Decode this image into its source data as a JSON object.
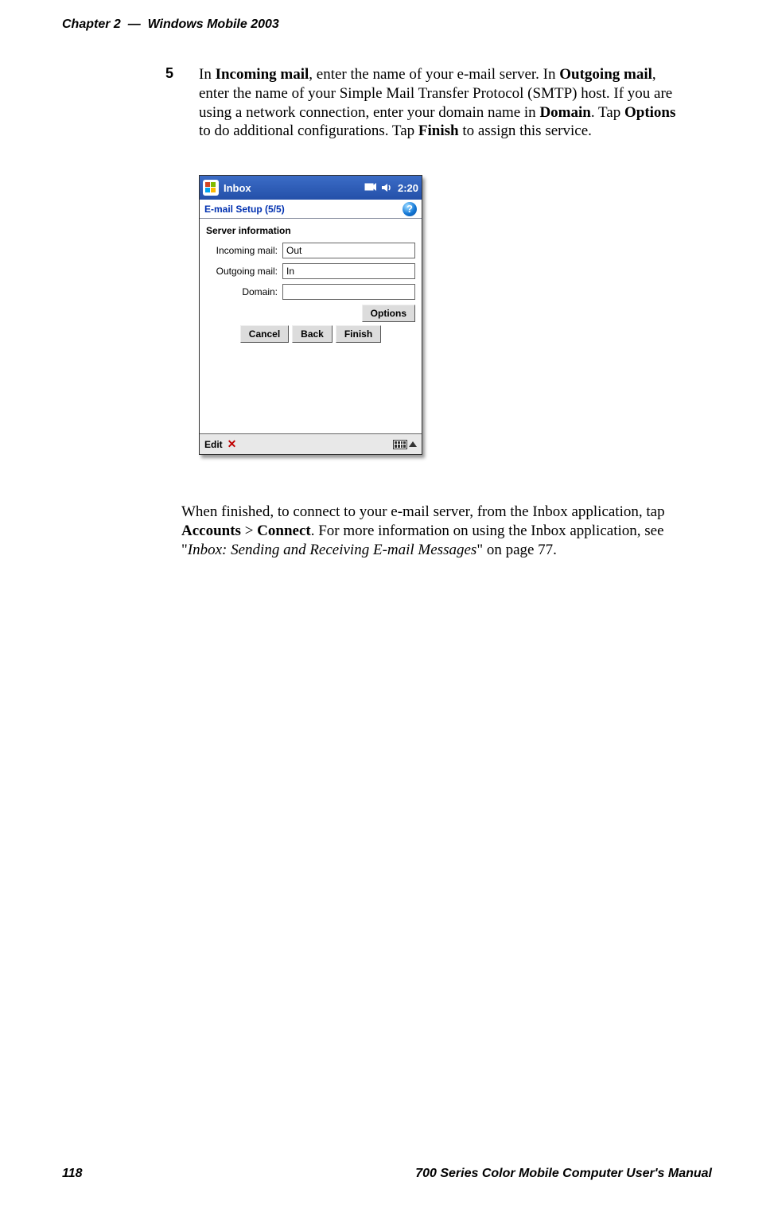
{
  "header": {
    "chapter_label": "Chapter 2",
    "dash": "—",
    "title": "Windows Mobile 2003"
  },
  "footer": {
    "page_number": "118",
    "manual_title": "700 Series Color Mobile Computer User's Manual"
  },
  "step": {
    "number": "5",
    "text_1": "In ",
    "bold_1": "Incoming mail",
    "text_2": ", enter the name of your e-mail server. In ",
    "bold_2": "Outgoing mail",
    "text_3": ", enter the name of your Simple Mail Transfer Protocol (SMTP) host. If you are using a network connection, enter your domain name in ",
    "bold_3": "Domain",
    "text_4": ". Tap ",
    "bold_4": "Options",
    "text_5": " to do additional configurations. Tap ",
    "bold_5": "Finish",
    "text_6": " to assign this service."
  },
  "screenshot": {
    "titlebar": {
      "app": "Inbox",
      "time": "2:20"
    },
    "subbar": {
      "title": "E-mail Setup (5/5)",
      "help": "?"
    },
    "section": "Server information",
    "fields": {
      "incoming_label": "Incoming mail:",
      "incoming_value": "Out",
      "outgoing_label": "Outgoing mail:",
      "outgoing_value": "In",
      "domain_label": "Domain:",
      "domain_value": ""
    },
    "buttons": {
      "options": "Options",
      "cancel": "Cancel",
      "back": "Back",
      "finish": "Finish"
    },
    "bottombar": {
      "edit": "Edit",
      "close": "✕"
    }
  },
  "closing": {
    "t1": "When finished, to connect to your e-mail server, from the Inbox application, tap ",
    "b1": "Accounts",
    "t2": " > ",
    "b2": "Connect",
    "t3": ". For more information on using the Inbox application, see \"",
    "i1": "Inbox: Sending and Receiving E-mail Messages",
    "t4": "\" on page 77."
  }
}
